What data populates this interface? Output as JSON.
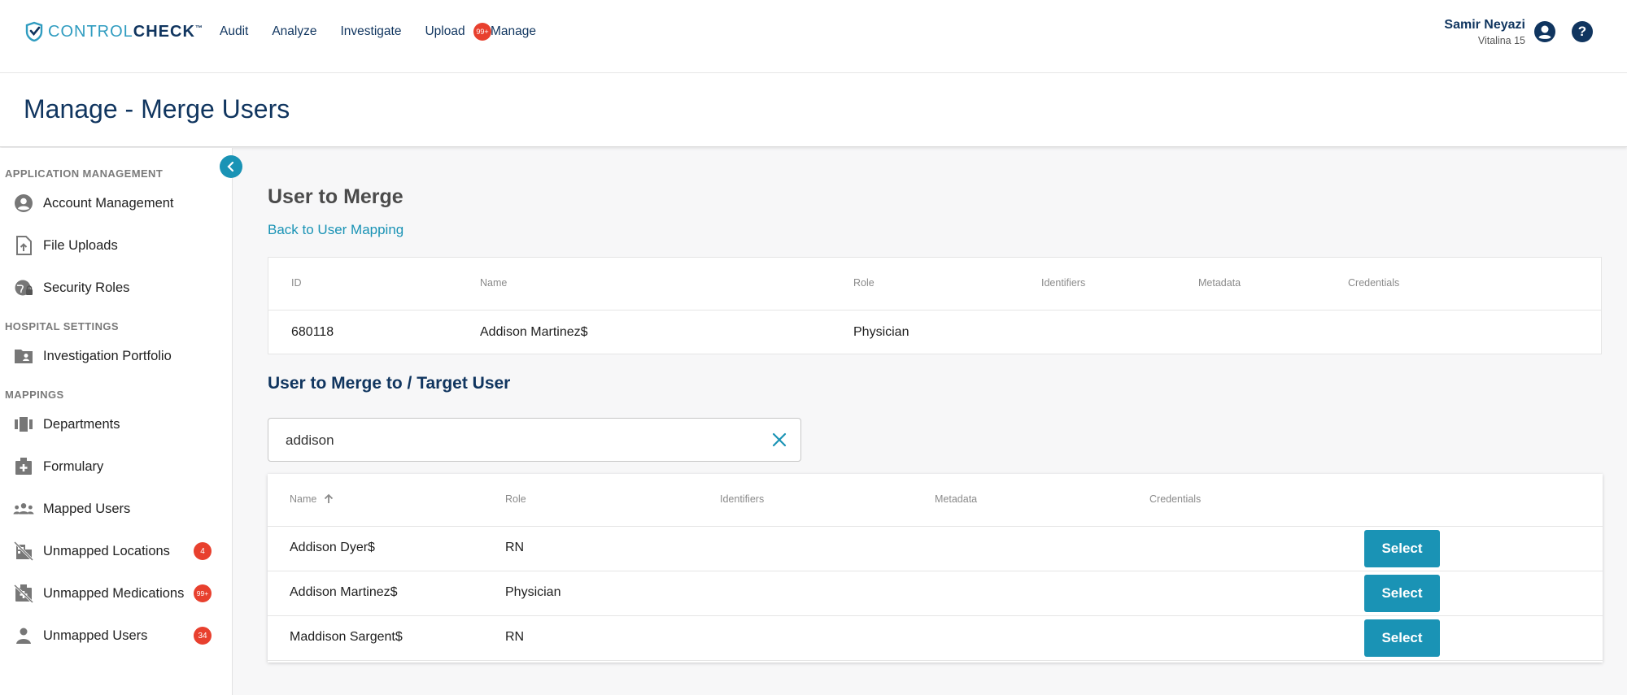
{
  "brand": {
    "name_part1": "CONTROL",
    "name_part2": "CHECK",
    "tm": "™"
  },
  "nav": {
    "items": [
      "Audit",
      "Analyze",
      "Investigate",
      "Upload"
    ],
    "upload_badge": "99+",
    "manage": "Manage"
  },
  "user": {
    "name": "Samir Neyazi",
    "org": "Vitalina 15"
  },
  "page": {
    "title": "Manage - Merge Users"
  },
  "sidebar": {
    "sections": [
      {
        "label": "APPLICATION MANAGEMENT"
      },
      {
        "label": "HOSPITAL SETTINGS"
      },
      {
        "label": "MAPPINGS"
      }
    ],
    "items": [
      {
        "label": "Account Management",
        "icon": "account-circle-icon"
      },
      {
        "label": "File Uploads",
        "icon": "file-upload-icon"
      },
      {
        "label": "Security Roles",
        "icon": "globe-lock-icon"
      },
      {
        "label": "Investigation Portfolio",
        "icon": "folder-user-icon"
      },
      {
        "label": "Departments",
        "icon": "departments-icon"
      },
      {
        "label": "Formulary",
        "icon": "medical-box-icon"
      },
      {
        "label": "Mapped Users",
        "icon": "group-icon"
      },
      {
        "label": "Unmapped Locations",
        "icon": "location-off-icon",
        "badge": "4"
      },
      {
        "label": "Unmapped Medications",
        "icon": "medical-off-icon",
        "badge": "99+"
      },
      {
        "label": "Unmapped Users",
        "icon": "person-icon",
        "badge": "34"
      }
    ]
  },
  "merge": {
    "heading": "User to Merge",
    "back_link": "Back to User Mapping",
    "columns": [
      "ID",
      "Name",
      "Role",
      "Identifiers",
      "Metadata",
      "Credentials"
    ],
    "row": {
      "id": "680118",
      "name": "Addison Martinez$",
      "role": "Physician"
    }
  },
  "target": {
    "heading": "User to Merge to / Target User",
    "search_value": "addison",
    "columns": [
      "Name",
      "Role",
      "Identifiers",
      "Metadata",
      "Credentials"
    ],
    "rows": [
      {
        "name": "Addison Dyer$",
        "role": "RN"
      },
      {
        "name": "Addison Martinez$",
        "role": "Physician"
      },
      {
        "name": "Maddison Sargent$",
        "role": "RN"
      }
    ],
    "select_label": "Select"
  },
  "colors": {
    "brand_navy": "#10355f",
    "accent_teal": "#1a93b5",
    "badge_red": "#e8402e"
  }
}
